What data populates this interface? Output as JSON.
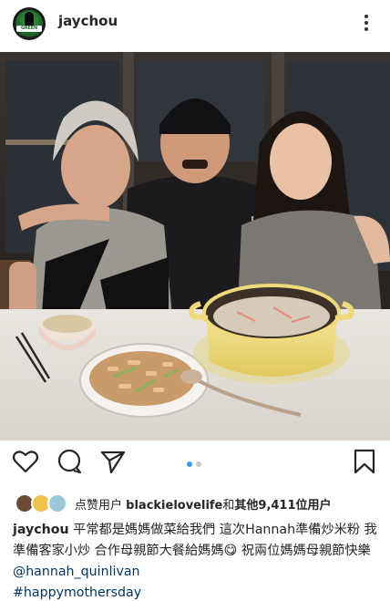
{
  "post": {
    "username": "jaychou",
    "avatar_badge": "GREEN HORNET",
    "more_icon": "more-vertical-icon"
  },
  "photo": {
    "description_icon": "family-dinner-photo"
  },
  "actions": {
    "like_icon": "heart-icon",
    "comment_icon": "comment-icon",
    "share_icon": "send-icon",
    "save_icon": "bookmark-icon",
    "carousel_count": 2,
    "carousel_active": 0
  },
  "likes": {
    "prefix": "点赞用户",
    "top_liker": "blackielovelife",
    "connector": "和",
    "others": "其他9,411位用户"
  },
  "caption": {
    "username": "jaychou",
    "text_part1": "平常都是媽媽做菜給我們 這次Hannah準備炒米粉 我準備客家小炒 合作母親節大餐給媽媽",
    "emoji": "😋",
    "text_part2": "祝兩位媽媽母親節快樂",
    "mention": "@hannah_quinlivan",
    "hashtag": "#happymothersday"
  },
  "colors": {
    "link": "#003569",
    "carousel_active": "#3897f0",
    "text": "#262626"
  }
}
